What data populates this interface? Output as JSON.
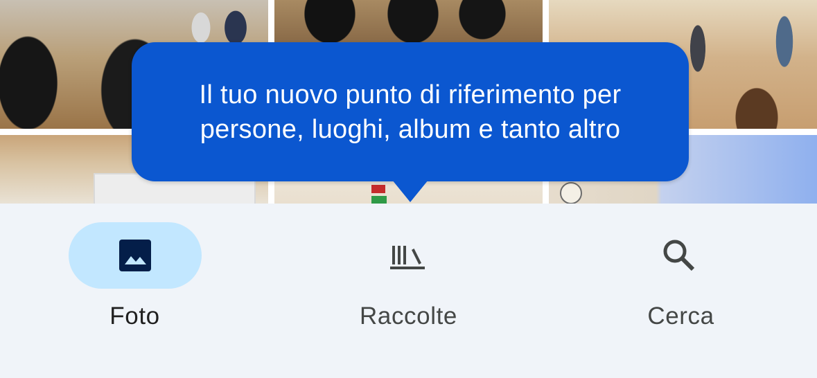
{
  "tooltip": {
    "line1": "Il tuo nuovo punto di riferimento per",
    "line2": "persone, luoghi, album e tanto altro"
  },
  "bottom_nav": {
    "items": [
      {
        "label": "Foto",
        "icon": "photo-icon",
        "selected": true
      },
      {
        "label": "Raccolte",
        "icon": "collections-icon",
        "selected": false
      },
      {
        "label": "Cerca",
        "icon": "search-icon",
        "selected": false
      }
    ]
  },
  "colors": {
    "tooltip_bg": "#0b57d0",
    "selected_pill": "#c2e7ff",
    "nav_bg": "#f0f4f9",
    "icon_selected": "#041e49",
    "icon_default": "#444746"
  }
}
